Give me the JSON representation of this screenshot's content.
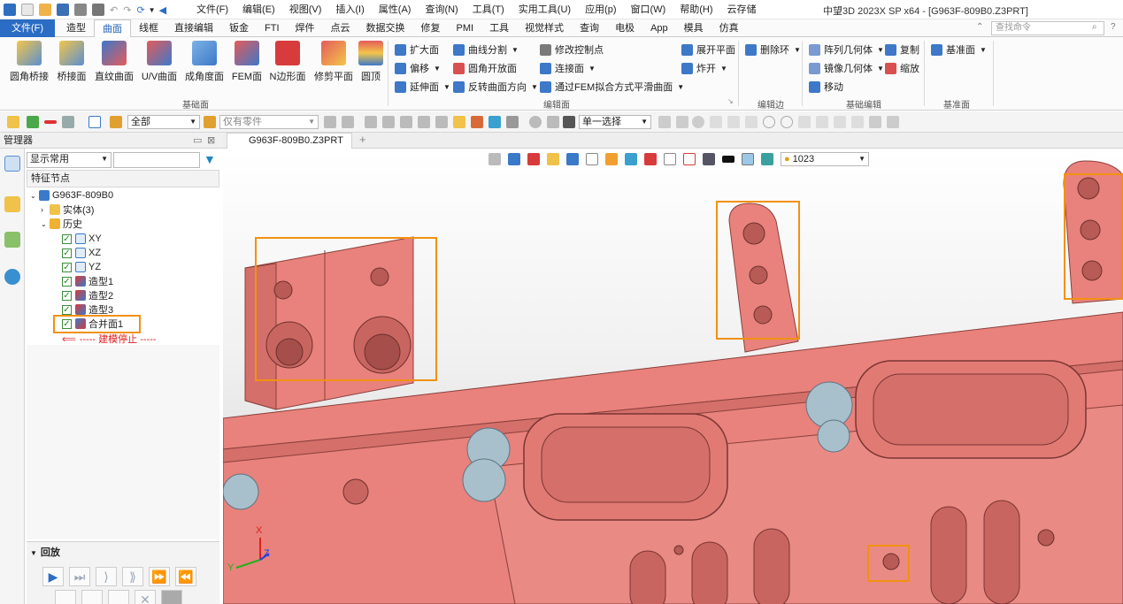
{
  "window": {
    "title": "中望3D 2023X SP x64 - [G963F-809B0.Z3PRT]",
    "menu": [
      "文件(F)",
      "编辑(E)",
      "视图(V)",
      "插入(I)",
      "属性(A)",
      "查询(N)",
      "工具(T)",
      "实用工具(U)",
      "应用(p)",
      "窗口(W)",
      "帮助(H)",
      "云存储"
    ]
  },
  "tabs": {
    "file": "文件(F)",
    "items": [
      "造型",
      "曲面",
      "线框",
      "直接编辑",
      "钣金",
      "FTI",
      "焊件",
      "点云",
      "数据交换",
      "修复",
      "PMI",
      "工具",
      "视觉样式",
      "查询",
      "电极",
      "App",
      "模具",
      "仿真"
    ],
    "active": "曲面",
    "search_placeholder": "查找命令"
  },
  "ribbon": {
    "basic_surface": {
      "group_label": "基础面",
      "buttons": [
        "圆角桥接",
        "桥接面",
        "直纹曲面",
        "U/V曲面",
        "成角度面",
        "FEM面",
        "N边形面",
        "修剪平面",
        "圆顶"
      ]
    },
    "edit_surface": {
      "group_label": "编辑面",
      "col1": [
        "扩大面",
        "偏移",
        "延伸面"
      ],
      "col2": [
        "曲线分割",
        "圆角开放面",
        "反转曲面方向"
      ],
      "col3": [
        "修改控制点",
        "连接面",
        "通过FEM拟合方式平滑曲面"
      ],
      "col4": [
        "展开平面",
        "炸开"
      ]
    },
    "edit_edge": {
      "group_label": "编辑边",
      "buttons": [
        "删除环"
      ]
    },
    "basic_edit": {
      "group_label": "基础编辑",
      "buttons": [
        "阵列几何体",
        "复制",
        "镜像几何体",
        "缩放",
        "移动"
      ]
    },
    "datum": {
      "group_label": "基准面",
      "buttons": [
        "基准面"
      ]
    }
  },
  "toolbar2": {
    "filter_value": "全部",
    "parts_value": "仅有零件",
    "select_mode": "单一选择"
  },
  "manager": {
    "title": "管理器",
    "display_option": "显示常用",
    "tree_header": "特征节点",
    "root": "G963F-809B0",
    "nodes": [
      {
        "label": "实体(3)",
        "level": 1,
        "checked": false
      },
      {
        "label": "历史",
        "level": 1,
        "checked": false
      },
      {
        "label": "XY",
        "level": 2,
        "checked": true
      },
      {
        "label": "XZ",
        "level": 2,
        "checked": true
      },
      {
        "label": "YZ",
        "level": 2,
        "checked": true
      },
      {
        "label": "造型1",
        "level": 2,
        "checked": true
      },
      {
        "label": "造型2",
        "level": 2,
        "checked": true
      },
      {
        "label": "造型3",
        "level": 2,
        "checked": true
      },
      {
        "label": "合并面1",
        "level": 2,
        "checked": true
      }
    ],
    "stop_marker": "----- 建模停止 -----",
    "playback_title": "回放"
  },
  "document": {
    "tab_label": "G963F-809B0.Z3PRT",
    "display_value": "1023"
  },
  "axes": {
    "x": "X",
    "y": "Y",
    "z": "Z"
  },
  "colors": {
    "accent": "#2b6cc4",
    "part": "#e9827c",
    "part_dark": "#c96560",
    "highlight": "#f29111",
    "stop_marker": "#e02020"
  }
}
